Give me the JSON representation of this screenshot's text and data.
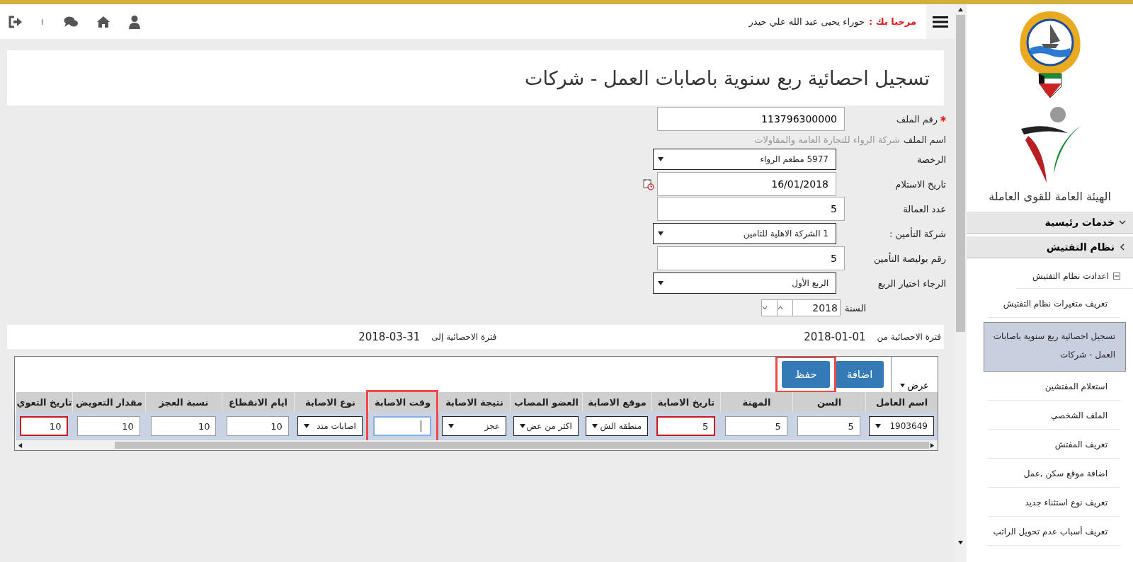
{
  "header": {
    "greeting": "مرحبا بك :",
    "user_name": "حوراء يحيى عبد الله علي حيدر"
  },
  "page_title": "تسجيل احصائية ربع سنوية باصابات العمل - شركات",
  "form": {
    "fields": [
      {
        "kind": "text",
        "label": "رقم الملف",
        "required": true,
        "value": "113796300000"
      },
      {
        "kind": "info",
        "label": "اسم الملف",
        "value": "شركة الرواء للتجارة العامه والمقاولات"
      },
      {
        "kind": "select",
        "label": "الرخصة",
        "value": "5977 مطعم الرواء"
      },
      {
        "kind": "date",
        "label": "تاريخ الاستلام",
        "value": "16/01/2018"
      },
      {
        "kind": "text",
        "label": "عدد العمالة",
        "value": "5"
      },
      {
        "kind": "select",
        "label": "شركة التأمين :",
        "value": "1 الشركة الاهلية للتامين"
      },
      {
        "kind": "text",
        "label": "رقم بوليصة التأمين",
        "value": "5"
      },
      {
        "kind": "select",
        "label": "الرجاء اختيار الربع",
        "value": "الربع الأول"
      },
      {
        "kind": "year",
        "label": "السنة",
        "value": "2018"
      }
    ]
  },
  "period": {
    "from_label": "فترة الاحصائية من",
    "from_value": "2018-01-01",
    "to_label": "فترة الاحصائية إلى",
    "to_value": "2018-03-31"
  },
  "grid": {
    "view_menu": "عرض",
    "buttons": [
      {
        "label": "اضافة",
        "highlighted": false
      },
      {
        "label": "حفظ",
        "highlighted": true
      }
    ],
    "columns": [
      {
        "title": "اسم العامل",
        "highlighted": false
      },
      {
        "title": "السن",
        "highlighted": false
      },
      {
        "title": "المهنة",
        "highlighted": false
      },
      {
        "title": "تاريخ الاصابة",
        "highlighted": false
      },
      {
        "title": "موقع الاصابة",
        "highlighted": false
      },
      {
        "title": "العضو المصاب",
        "highlighted": false
      },
      {
        "title": "نتيجة الاصابة",
        "highlighted": false
      },
      {
        "title": "وقت الاصابة",
        "highlighted": true
      },
      {
        "title": "نوع الاصابة",
        "highlighted": false
      },
      {
        "title": "ايام الانقطاع",
        "highlighted": false
      },
      {
        "title": "نسبة العجز",
        "highlighted": false
      },
      {
        "title": "مقدار التعويض",
        "highlighted": false
      },
      {
        "title": "تاريخ التعوي",
        "highlighted": false
      }
    ],
    "rows": [
      {
        "cells": [
          {
            "kind": "select",
            "value": "1903649",
            "invalid": false,
            "focused": false
          },
          {
            "kind": "input",
            "value": "5",
            "invalid": false,
            "focused": false
          },
          {
            "kind": "input",
            "value": "5",
            "invalid": false,
            "focused": false
          },
          {
            "kind": "input",
            "value": "5",
            "invalid": true,
            "focused": false
          },
          {
            "kind": "select",
            "value": "منطقه الش",
            "invalid": false,
            "focused": false
          },
          {
            "kind": "select",
            "value": "اكثر من عض",
            "invalid": false,
            "focused": false
          },
          {
            "kind": "select",
            "value": "عجز",
            "invalid": false,
            "focused": false
          },
          {
            "kind": "input",
            "invalid": false,
            "focused": true
          },
          {
            "kind": "select",
            "value": "اصابات متد",
            "invalid": false,
            "focused": false
          },
          {
            "kind": "input",
            "value": "10",
            "invalid": false,
            "focused": false
          },
          {
            "kind": "input",
            "value": "10",
            "invalid": false,
            "focused": false
          },
          {
            "kind": "input",
            "value": "10",
            "invalid": false,
            "focused": false
          },
          {
            "kind": "input",
            "value": "10",
            "invalid": true,
            "focused": false
          }
        ]
      }
    ]
  },
  "sidebar": {
    "org_name": "الهيئة العامة للقوى العاملة",
    "sections": [
      {
        "label": "خدمات رئيسية",
        "expanded": false
      },
      {
        "label": "نظام التفتيش",
        "expanded": true,
        "children": [
          {
            "label": "اعدادت نظام التفتيش",
            "expanded": true,
            "children": [
              {
                "label": "تعريف متغيرات نظام التفتيش",
                "selected": false
              },
              {
                "label": "تسجيل احصائية ربع سنوية باصابات العمل - شركات",
                "selected": true
              },
              {
                "label": "استعلام المفتشين",
                "selected": false
              },
              {
                "label": "الملف الشخصي",
                "selected": false
              },
              {
                "label": "تعريف المفتش",
                "selected": false
              },
              {
                "label": "اضافة موقع سكن ,عمل",
                "selected": false
              },
              {
                "label": "تعريف نوع استثناء جديد",
                "selected": false
              },
              {
                "label": "تعريف أسباب عدم تحويل الراتب",
                "selected": false
              }
            ]
          }
        ]
      }
    ]
  }
}
